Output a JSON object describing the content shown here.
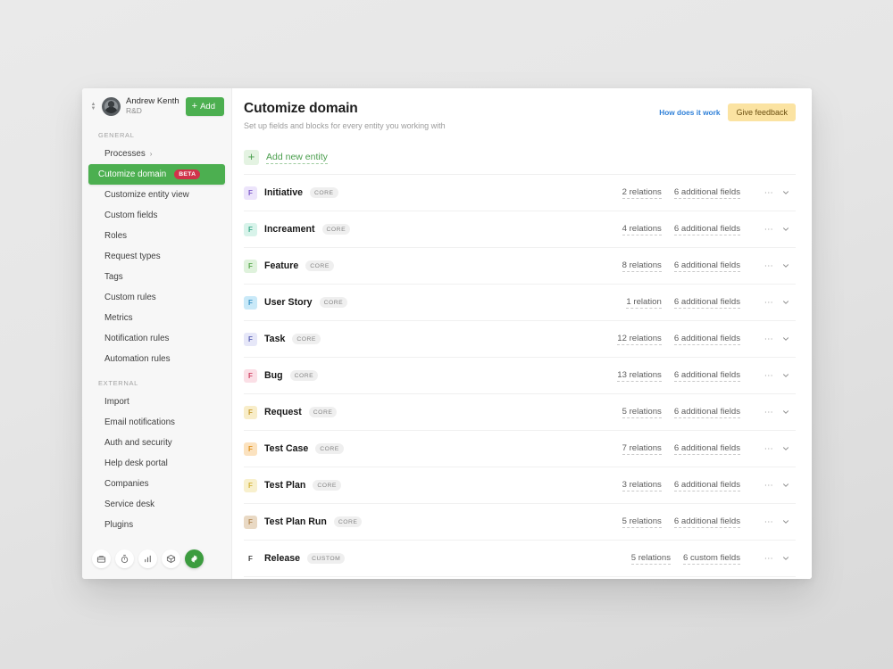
{
  "sidebar": {
    "user": {
      "name": "Andrew Kenth",
      "subtitle": "R&D",
      "avatar_icon": "user-avatar"
    },
    "add_button": {
      "label": "Add",
      "icon": "plus-icon"
    },
    "sections": [
      {
        "label": "GENERAL",
        "items": [
          {
            "label": "Processes",
            "has_chevron": true,
            "chevron": "›",
            "active": false
          },
          {
            "label": "Cutomize domain",
            "badge": "BETA",
            "active": true
          },
          {
            "label": "Customize entity view",
            "active": false
          },
          {
            "label": "Custom fields",
            "active": false
          },
          {
            "label": "Roles",
            "active": false
          },
          {
            "label": "Request types",
            "active": false
          },
          {
            "label": "Tags",
            "active": false
          },
          {
            "label": "Custom rules",
            "active": false
          },
          {
            "label": "Metrics",
            "active": false
          },
          {
            "label": "Notification rules",
            "active": false
          },
          {
            "label": "Automation rules",
            "active": false
          }
        ]
      },
      {
        "label": "EXTERNAL",
        "items": [
          {
            "label": "Import",
            "active": false
          },
          {
            "label": "Email notifications",
            "active": false
          },
          {
            "label": "Auth and security",
            "active": false
          },
          {
            "label": "Help desk portal",
            "active": false
          },
          {
            "label": "Companies",
            "active": false
          },
          {
            "label": "Service desk",
            "active": false
          },
          {
            "label": "Plugins",
            "active": false
          }
        ]
      }
    ],
    "bottom_icons": [
      {
        "name": "briefcase-icon",
        "active": false
      },
      {
        "name": "timer-icon",
        "active": false
      },
      {
        "name": "bar-chart-icon",
        "active": false
      },
      {
        "name": "box-icon",
        "active": false
      },
      {
        "name": "gear-icon",
        "active": true
      }
    ]
  },
  "header": {
    "title": "Cutomize domain",
    "subtitle": "Set up fields and blocks for every entity you working with",
    "how_link": "How does it work",
    "feedback_button": "Give feedback"
  },
  "add_entity": {
    "label": "Add new entity",
    "icon": "plus-icon"
  },
  "colors": {
    "accent_green": "#4caf50",
    "beta_red": "#d0334a",
    "link_blue": "#2f80d8",
    "feedback_yellow": "#fbe3a2"
  },
  "entities": [
    {
      "icon_letter": "F",
      "icon_bg": "#ece4fb",
      "icon_fg": "#7c5bc9",
      "name": "Initiative",
      "kind": "CORE",
      "relations": "2 relations",
      "fields": "6 additional fields"
    },
    {
      "icon_letter": "F",
      "icon_bg": "#d8f3ea",
      "icon_fg": "#3aa98a",
      "name": "Increament",
      "kind": "CORE",
      "relations": "4 relations",
      "fields": "6 additional fields"
    },
    {
      "icon_letter": "F",
      "icon_bg": "#dff2dc",
      "icon_fg": "#5aa94f",
      "name": "Feature",
      "kind": "CORE",
      "relations": "8 relations",
      "fields": "6 additional fields"
    },
    {
      "icon_letter": "F",
      "icon_bg": "#c9e9f8",
      "icon_fg": "#3a93c6",
      "name": "User Story",
      "kind": "CORE",
      "relations": "1 relation",
      "fields": "6 additional fields"
    },
    {
      "icon_letter": "F",
      "icon_bg": "#e6e7f8",
      "icon_fg": "#5c63b5",
      "name": "Task",
      "kind": "CORE",
      "relations": "12 relations",
      "fields": "6 additional fields"
    },
    {
      "icon_letter": "F",
      "icon_bg": "#fbdfe6",
      "icon_fg": "#cf4466",
      "name": "Bug",
      "kind": "CORE",
      "relations": "13 relations",
      "fields": "6 additional fields"
    },
    {
      "icon_letter": "F",
      "icon_bg": "#f8edc9",
      "icon_fg": "#c79b2f",
      "name": "Request",
      "kind": "CORE",
      "relations": "5 relations",
      "fields": "6 additional fields"
    },
    {
      "icon_letter": "F",
      "icon_bg": "#fbe2bf",
      "icon_fg": "#e0911f",
      "name": "Test Case",
      "kind": "CORE",
      "relations": "7 relations",
      "fields": "6 additional fields"
    },
    {
      "icon_letter": "F",
      "icon_bg": "#f8f0cd",
      "icon_fg": "#d4b33a",
      "name": "Test Plan",
      "kind": "CORE",
      "relations": "3 relations",
      "fields": "6 additional fields"
    },
    {
      "icon_letter": "F",
      "icon_bg": "#e9d9c4",
      "icon_fg": "#b48a55",
      "name": "Test Plan Run",
      "kind": "CORE",
      "relations": "5 relations",
      "fields": "6 additional fields"
    },
    {
      "icon_letter": "F",
      "icon_bg": "#ffffff",
      "icon_fg": "#3d3d3d",
      "name": "Release",
      "kind": "CUSTOM",
      "relations": "5 relations",
      "fields": "6 custom fields"
    }
  ]
}
